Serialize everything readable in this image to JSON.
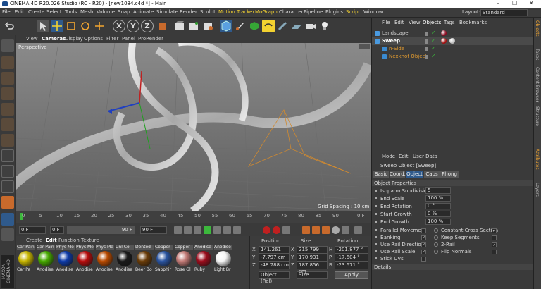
{
  "window": {
    "title": "CINEMA 4D R20.026 Studio (RC - R20) - [new1084.c4d *] - Main"
  },
  "menu": [
    "File",
    "Edit",
    "Create",
    "Select",
    "Tools",
    "Mesh",
    "Volume",
    "Snap",
    "Animate",
    "Simulate",
    "Render",
    "Sculpt",
    "Motion Tracker",
    "MoGraph",
    "Character",
    "Pipeline",
    "Plugins",
    "Script",
    "Window"
  ],
  "layout": {
    "label": "Layout:",
    "value": "Standard"
  },
  "viewport": {
    "menu": [
      "View",
      "Cameras",
      "Display",
      "Options",
      "Filter",
      "Panel",
      "ProRender"
    ],
    "name": "Perspective",
    "grid_spacing": "Grid Spacing : 10 cm"
  },
  "timeline": {
    "ticks": [
      "0",
      "5",
      "10",
      "15",
      "20",
      "25",
      "30",
      "35",
      "40",
      "45",
      "50",
      "55",
      "60",
      "65",
      "70",
      "75",
      "80",
      "85",
      "90"
    ],
    "end_label": "0 F"
  },
  "transport": {
    "current": "0 F",
    "start": "0 F",
    "end": "90 F",
    "end2": "90 F"
  },
  "materials": {
    "menu": [
      "Create",
      "Edit",
      "Function",
      "Texture"
    ],
    "items": [
      {
        "label": "Car Pain",
        "name": "Car Pa",
        "color": "#c6b400"
      },
      {
        "label": "Car Pain",
        "name": "Anodise",
        "color": "#46a800"
      },
      {
        "label": "Phys Me",
        "name": "Anodise",
        "color": "#0d3aa8"
      },
      {
        "label": "Phys Me",
        "name": "Anodise",
        "color": "#b60b0b"
      },
      {
        "label": "Phys Me",
        "name": "Anodise",
        "color": "#b84a00"
      },
      {
        "label": "Unl Co",
        "name": "Anodise",
        "color": "#1a1a1a"
      },
      {
        "label": "Dented",
        "name": "Beer Bo",
        "color": "#6a3c08"
      },
      {
        "label": "Copper",
        "name": "Sapphir",
        "color": "#2a54a0"
      },
      {
        "label": "Copper",
        "name": "Rose Gl",
        "color": "#c27a76"
      },
      {
        "label": "Anodise",
        "name": "Ruby",
        "color": "#9c0c1c"
      },
      {
        "label": "Anodise",
        "name": "Light Br",
        "color": "#f4f4f4"
      }
    ]
  },
  "coordinates": {
    "headers": [
      "Position",
      "Size",
      "Rotation"
    ],
    "rows": [
      {
        "axis": "X",
        "pos": "141.261 cm",
        "size_axis": "X",
        "size": "215.799 cm",
        "rot_axis": "H",
        "rot": "-201.877 °"
      },
      {
        "axis": "Y",
        "pos": "-7.797 cm",
        "size_axis": "Y",
        "size": "170.931 cm",
        "rot_axis": "P",
        "rot": "-17.604 °"
      },
      {
        "axis": "Z",
        "pos": "-48.788 cm",
        "size_axis": "Z",
        "size": "187.856 cm",
        "rot_axis": "B",
        "rot": "-23.671 °"
      }
    ],
    "mode": "Object (Rel)",
    "size_mode": "Size",
    "apply": "Apply"
  },
  "object_manager": {
    "menu": [
      "File",
      "Edit",
      "View",
      "Objects",
      "Tags",
      "Bookmarks"
    ],
    "objects": [
      {
        "name": "Landscape",
        "indent": 0,
        "color": "#d0d0d0",
        "selected": false
      },
      {
        "name": "Sweep",
        "indent": 0,
        "color": "#ffffff",
        "selected": true
      },
      {
        "name": "n-Side",
        "indent": 1,
        "color": "#e09a30",
        "selected": false
      },
      {
        "name": "Nexknot Object",
        "indent": 1,
        "color": "#e09a30",
        "selected": false
      }
    ]
  },
  "attributes": {
    "menu": [
      "Mode",
      "Edit",
      "User Data"
    ],
    "object_title": "Sweep Object [Sweep]",
    "tabs": [
      "Basic",
      "Coord.",
      "Object",
      "Caps",
      "Phong"
    ],
    "active_tab": "Object",
    "section": "Object Properties",
    "fields": [
      {
        "label": "Isoparm Subdivision",
        "value": "5"
      },
      {
        "label": "End Scale",
        "value": "100 %"
      },
      {
        "label": "End Rotation",
        "value": "0 °"
      },
      {
        "label": "Start Growth",
        "value": "0 %"
      },
      {
        "label": "End Growth",
        "value": "100 %"
      }
    ],
    "checks_left": [
      {
        "label": "Parallel Movement",
        "checked": false
      },
      {
        "label": "Banking",
        "checked": true
      },
      {
        "label": "Use Rail Direction",
        "checked": true
      },
      {
        "label": "Use Rail Scale",
        "checked": true
      },
      {
        "label": "Stick UVs",
        "checked": false
      }
    ],
    "checks_right": [
      {
        "label": "Constant Cross Section",
        "checked": true
      },
      {
        "label": "Keep Segments",
        "checked": false
      },
      {
        "label": "2-Rail",
        "checked": true
      },
      {
        "label": "Flip Normals",
        "checked": false
      }
    ],
    "details": "Details"
  },
  "right_tabs": [
    "Objects",
    "Takes",
    "Content Browser",
    "Structure",
    "Attributes",
    "Layers"
  ],
  "colors": {
    "accent": "#f3d230",
    "selected_tab": "#2f5a8c",
    "bg": "#333333"
  }
}
